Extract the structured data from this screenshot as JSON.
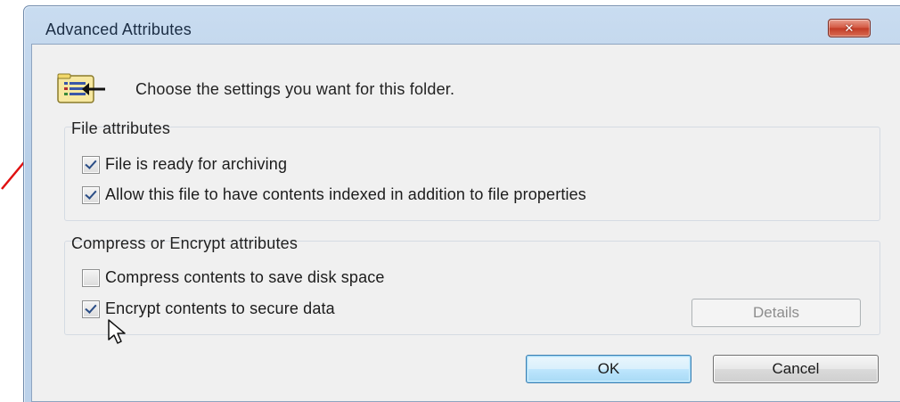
{
  "window": {
    "title": "Advanced Attributes",
    "close_icon": "close-icon"
  },
  "header": {
    "icon": "folder-properties-icon",
    "text": "Choose the settings you want for this folder."
  },
  "file_attributes": {
    "label": "File attributes",
    "options": [
      {
        "label": "File is ready for archiving",
        "checked": true
      },
      {
        "label": "Allow this file to have contents indexed in addition to file properties",
        "checked": true
      }
    ]
  },
  "compress_encrypt": {
    "label": "Compress or Encrypt attributes",
    "options": [
      {
        "label": "Compress contents to save disk space",
        "checked": false
      },
      {
        "label": "Encrypt contents to secure data",
        "checked": true
      }
    ],
    "details_label": "Details"
  },
  "buttons": {
    "ok_label": "OK",
    "cancel_label": "Cancel"
  },
  "colors": {
    "title_bar": "#c2d8ef",
    "client_bg": "#f0f0f0",
    "close_button": "#d2553f",
    "annotation_arrow": "#e01010"
  }
}
